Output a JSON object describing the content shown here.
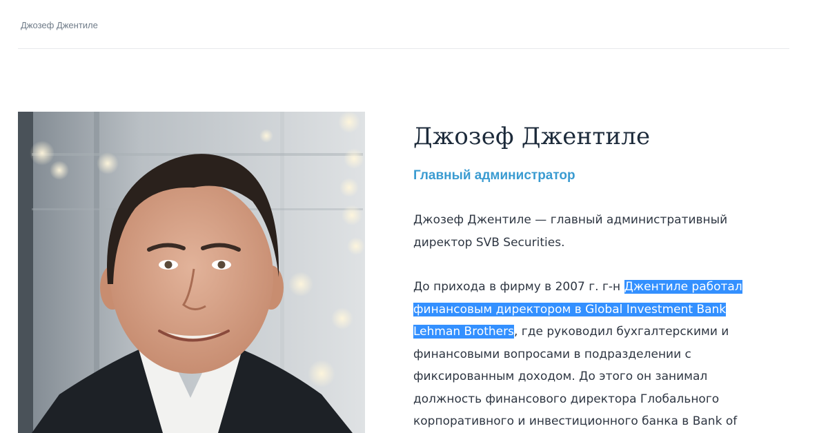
{
  "breadcrumb": "Джозеф Джентиле",
  "profile": {
    "name": "Джозеф Джентиле",
    "role": "Главный администратор",
    "bio_p1": "Джозеф Джентиле — главный административный директор SVB Securities.",
    "bio_p2_before": "До прихода в фирму в 2007 г. г-н ",
    "bio_p2_selected": "Джентиле работал финансовым директором в Global Investment Bank Lehman Brothers",
    "bio_p2_after": ", где руководил бухгалтерскими и финансовыми вопросами в подразделении с фиксированным доходом. До этого он занимал должность финансового директора Глобального корпоративного и инвестиционного банка в Bank of"
  },
  "colors": {
    "accent": "#3a9bd1",
    "selection": "#3390ff",
    "heading": "#1c2a3a"
  }
}
